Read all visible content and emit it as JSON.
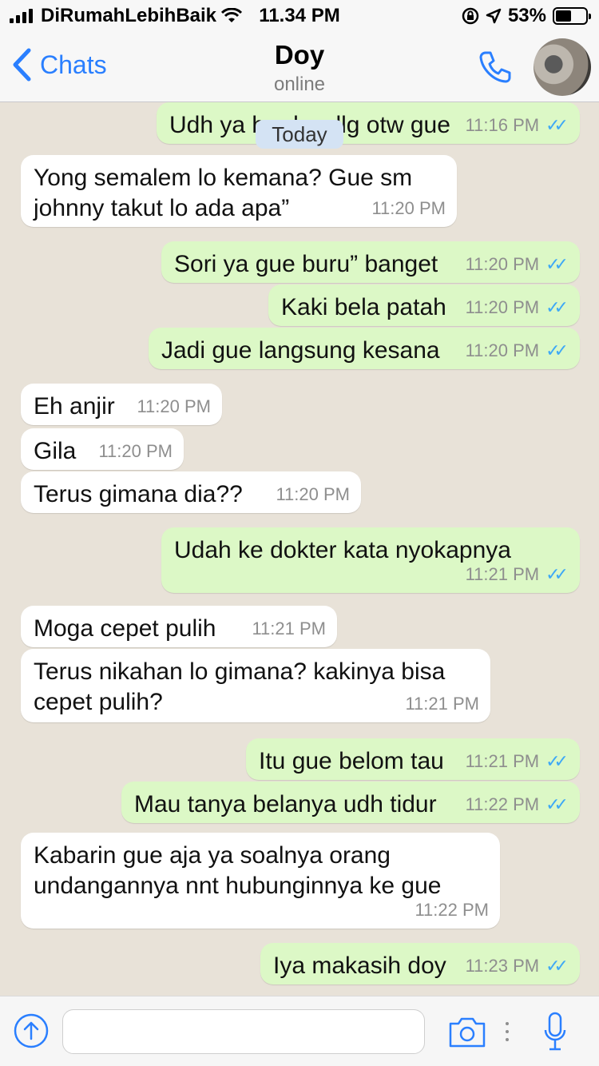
{
  "status_bar": {
    "carrier": "DiRumahLebihBaik",
    "time": "11.34 PM",
    "battery_text": "53%",
    "battery_level": 0.53
  },
  "header": {
    "back_label": "Chats",
    "contact_name": "Doy",
    "contact_status": "online"
  },
  "chat": {
    "date_chip": "Today",
    "messages": [
      {
        "dir": "out",
        "text": "Udh ya bro berdlg otw gue",
        "time": "11:16 PM"
      },
      {
        "dir": "in",
        "text": "Yong semalem lo kemana? Gue sm johnny takut lo ada apa”",
        "time": "11:20 PM"
      },
      {
        "dir": "out",
        "text": "Sori ya gue buru” banget",
        "time": "11:20 PM"
      },
      {
        "dir": "out",
        "text": "Kaki bela patah",
        "time": "11:20 PM"
      },
      {
        "dir": "out",
        "text": "Jadi gue langsung kesana",
        "time": "11:20 PM"
      },
      {
        "dir": "in",
        "text": "Eh anjir",
        "time": "11:20 PM"
      },
      {
        "dir": "in",
        "text": "Gila",
        "time": "11:20 PM"
      },
      {
        "dir": "in",
        "text": "Terus gimana dia??",
        "time": "11:20 PM"
      },
      {
        "dir": "out",
        "text": "Udah ke dokter kata nyokapnya",
        "time": "11:21 PM"
      },
      {
        "dir": "in",
        "text": "Moga cepet pulih",
        "time": "11:21 PM"
      },
      {
        "dir": "in",
        "text": "Terus nikahan lo gimana? kakinya bisa cepet pulih?",
        "time": "11:21 PM"
      },
      {
        "dir": "out",
        "text": "Itu gue belom tau",
        "time": "11:21 PM"
      },
      {
        "dir": "out",
        "text": "Mau tanya belanya udh tidur",
        "time": "11:22 PM"
      },
      {
        "dir": "in",
        "text": "Kabarin gue aja ya soalnya orang undangannya nnt hubunginnya ke gue",
        "time": "11:22 PM"
      },
      {
        "dir": "out",
        "text": "Iya makasih doy",
        "time": "11:23 PM"
      }
    ]
  },
  "input_bar": {
    "message_placeholder": ""
  },
  "icons": {
    "back": "chevron-left-icon",
    "call": "phone-icon",
    "attach": "arrow-up-circle-icon",
    "camera": "camera-icon",
    "more": "dots-vertical-icon",
    "mic": "microphone-icon",
    "read": "double-check-icon"
  },
  "colors": {
    "accent": "#2A7FFF",
    "outgoing_bubble": "#DCF8C6",
    "incoming_bubble": "#FFFFFF",
    "read_ticks": "#3EA8F6",
    "chat_background": "#E8E2D8"
  }
}
